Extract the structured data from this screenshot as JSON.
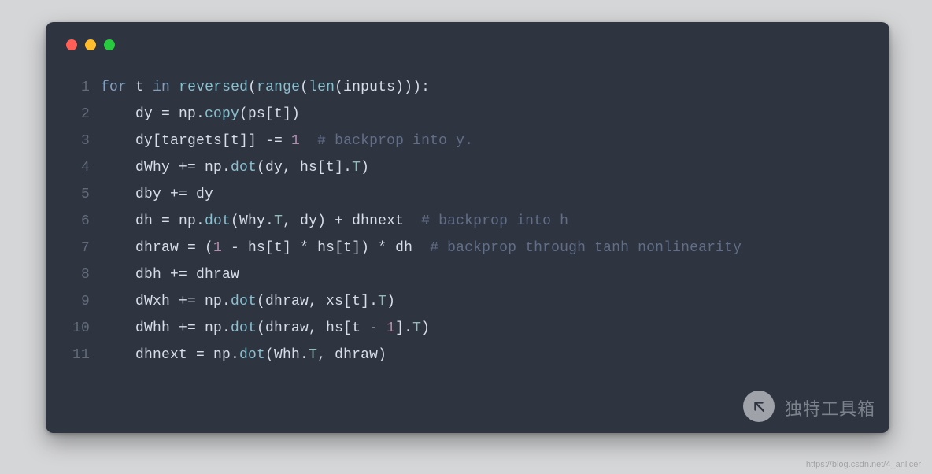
{
  "code": {
    "lines": [
      {
        "n": "1",
        "tokens": [
          {
            "cls": "kw",
            "t": "for"
          },
          {
            "cls": "",
            "t": " t "
          },
          {
            "cls": "kw",
            "t": "in"
          },
          {
            "cls": "",
            "t": " "
          },
          {
            "cls": "fn",
            "t": "reversed"
          },
          {
            "cls": "",
            "t": "("
          },
          {
            "cls": "fn",
            "t": "range"
          },
          {
            "cls": "",
            "t": "("
          },
          {
            "cls": "fn",
            "t": "len"
          },
          {
            "cls": "",
            "t": "(inputs))):"
          }
        ]
      },
      {
        "n": "2",
        "tokens": [
          {
            "cls": "",
            "t": "    dy = np."
          },
          {
            "cls": "fn",
            "t": "copy"
          },
          {
            "cls": "",
            "t": "(ps[t])"
          }
        ]
      },
      {
        "n": "3",
        "tokens": [
          {
            "cls": "",
            "t": "    dy[targets[t]] -= "
          },
          {
            "cls": "num",
            "t": "1"
          },
          {
            "cls": "",
            "t": "  "
          },
          {
            "cls": "cm",
            "t": "# backprop into y."
          }
        ]
      },
      {
        "n": "4",
        "tokens": [
          {
            "cls": "",
            "t": "    dWhy += np."
          },
          {
            "cls": "fn",
            "t": "dot"
          },
          {
            "cls": "",
            "t": "(dy, hs[t]."
          },
          {
            "cls": "mem",
            "t": "T"
          },
          {
            "cls": "",
            "t": ")"
          }
        ]
      },
      {
        "n": "5",
        "tokens": [
          {
            "cls": "",
            "t": "    dby += dy"
          }
        ]
      },
      {
        "n": "6",
        "tokens": [
          {
            "cls": "",
            "t": "    dh = np."
          },
          {
            "cls": "fn",
            "t": "dot"
          },
          {
            "cls": "",
            "t": "(Why."
          },
          {
            "cls": "mem",
            "t": "T"
          },
          {
            "cls": "",
            "t": ", dy) + dhnext  "
          },
          {
            "cls": "cm",
            "t": "# backprop into h"
          }
        ]
      },
      {
        "n": "7",
        "tokens": [
          {
            "cls": "",
            "t": "    dhraw = ("
          },
          {
            "cls": "num",
            "t": "1"
          },
          {
            "cls": "",
            "t": " - hs[t] * hs[t]) * dh  "
          },
          {
            "cls": "cm",
            "t": "# backprop through tanh nonlinearity"
          }
        ]
      },
      {
        "n": "8",
        "tokens": [
          {
            "cls": "",
            "t": "    dbh += dhraw"
          }
        ]
      },
      {
        "n": "9",
        "tokens": [
          {
            "cls": "",
            "t": "    dWxh += np."
          },
          {
            "cls": "fn",
            "t": "dot"
          },
          {
            "cls": "",
            "t": "(dhraw, xs[t]."
          },
          {
            "cls": "mem",
            "t": "T"
          },
          {
            "cls": "",
            "t": ")"
          }
        ]
      },
      {
        "n": "10",
        "tokens": [
          {
            "cls": "",
            "t": "    dWhh += np."
          },
          {
            "cls": "fn",
            "t": "dot"
          },
          {
            "cls": "",
            "t": "(dhraw, hs[t - "
          },
          {
            "cls": "num",
            "t": "1"
          },
          {
            "cls": "",
            "t": "]."
          },
          {
            "cls": "mem",
            "t": "T"
          },
          {
            "cls": "",
            "t": ")"
          }
        ]
      },
      {
        "n": "11",
        "tokens": [
          {
            "cls": "",
            "t": "    dhnext = np."
          },
          {
            "cls": "fn",
            "t": "dot"
          },
          {
            "cls": "",
            "t": "(Whh."
          },
          {
            "cls": "mem",
            "t": "T"
          },
          {
            "cls": "",
            "t": ", dhraw)"
          }
        ]
      }
    ]
  },
  "watermark": {
    "text": "独特工具箱",
    "footer": "https://blog.csdn.net/4_anlicer"
  }
}
